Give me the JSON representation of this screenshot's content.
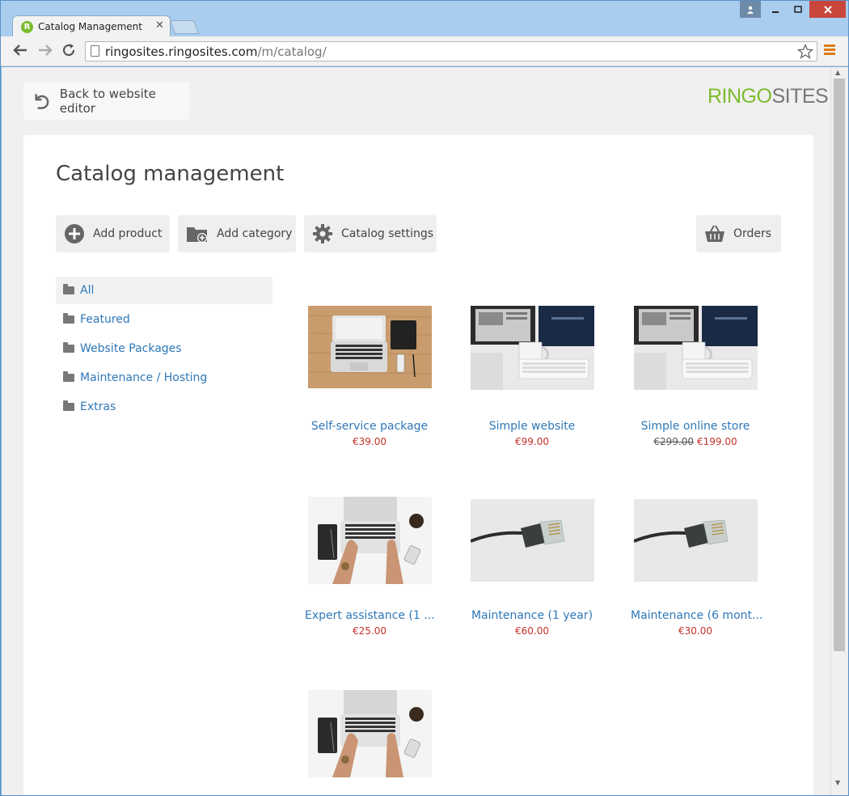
{
  "browser": {
    "tab_title": "Catalog Management",
    "tab_close": "✕",
    "favicon_letter": "R",
    "url_host": "ringosites.ringosites.com",
    "url_path": "/m/catalog/"
  },
  "header": {
    "back_label": "Back to website editor",
    "logo_part1": "RINGO",
    "logo_part2": "SITES",
    "logo_color_primary": "#7cbb2e",
    "logo_color_secondary": "#777777"
  },
  "main": {
    "title": "Catalog management",
    "actions": {
      "add_product": "Add product",
      "add_category": "Add category",
      "catalog_settings": "Catalog settings",
      "orders": "Orders"
    }
  },
  "categories": [
    {
      "label": "All",
      "active": true
    },
    {
      "label": "Featured",
      "active": false
    },
    {
      "label": "Website Packages",
      "active": false
    },
    {
      "label": "Maintenance / Hosting",
      "active": false
    },
    {
      "label": "Extras",
      "active": false
    }
  ],
  "products": [
    {
      "name": "Self-service package",
      "price": "€39.00",
      "old_price": "",
      "image": "laptop-desk-icon"
    },
    {
      "name": "Simple website",
      "price": "€99.00",
      "old_price": "",
      "image": "monitor-keyboard-icon"
    },
    {
      "name": "Simple online store",
      "price": "€199.00",
      "old_price": "€299.00",
      "image": "monitor-keyboard-icon"
    },
    {
      "name": "Expert assistance (1 ...",
      "price": "€25.00",
      "old_price": "",
      "image": "hands-laptop-icon"
    },
    {
      "name": "Maintenance (1 year)",
      "price": "€60.00",
      "old_price": "",
      "image": "ethernet-cable-icon"
    },
    {
      "name": "Maintenance (6 mont...",
      "price": "€30.00",
      "old_price": "",
      "image": "ethernet-cable-icon"
    },
    {
      "name": "",
      "price": "",
      "old_price": "",
      "image": "hands-laptop-icon"
    }
  ],
  "colors": {
    "link": "#2f78b8",
    "price": "#c4322b",
    "accent_menu": "#e07b10"
  }
}
